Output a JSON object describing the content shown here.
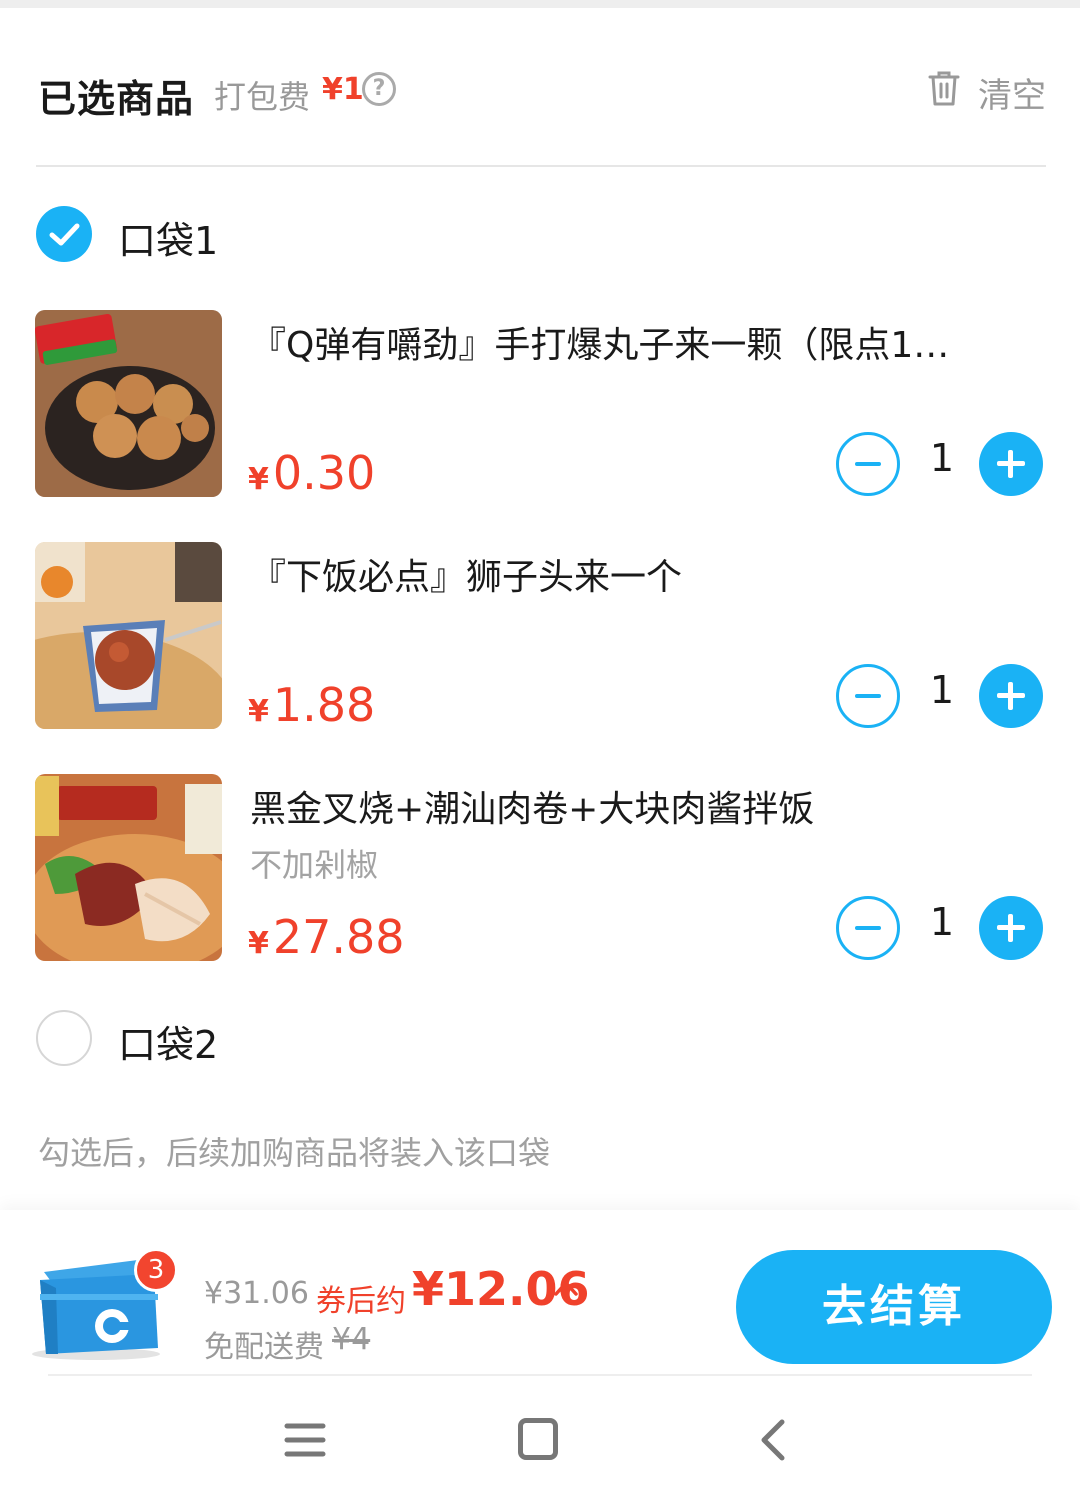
{
  "header": {
    "title": "已选商品",
    "pack_fee_label": "打包费",
    "pack_fee_value": "¥1",
    "help_icon": "?",
    "clear_label": "清空"
  },
  "bags": [
    {
      "label": "口袋1",
      "checked": true,
      "items": [
        {
          "name": "『Q弹有嚼劲』手打爆丸子来一颗（限点1…",
          "spec": "",
          "currency": "¥",
          "price": "0.30",
          "qty": "1"
        },
        {
          "name": "『下饭必点』狮子头来一个",
          "spec": "",
          "currency": "¥",
          "price": "1.88",
          "qty": "1"
        },
        {
          "name": "黑金叉烧+潮汕肉卷+大块肉酱拌饭",
          "spec": "不加剁椒",
          "currency": "¥",
          "price": "27.88",
          "qty": "1"
        }
      ]
    },
    {
      "label": "口袋2",
      "checked": false,
      "items": []
    }
  ],
  "hint": "勾选后，后续加购商品将装入该口袋",
  "cart": {
    "badge_count": "3",
    "original_total": "¥31.06",
    "coupon_label": "券后约",
    "final_total": "¥12.06",
    "free_delivery_label": "免配送费",
    "delivery_fee": "¥4",
    "checkout_label": "去结算"
  },
  "colors": {
    "accent": "#1ab2f5",
    "price": "#f0412b",
    "muted": "#999999"
  },
  "icons": [
    "help-icon",
    "trash-icon",
    "check-icon",
    "minus-icon",
    "plus-icon",
    "cart-box-icon",
    "caret-up-icon",
    "menu-icon",
    "home-icon",
    "back-icon"
  ]
}
